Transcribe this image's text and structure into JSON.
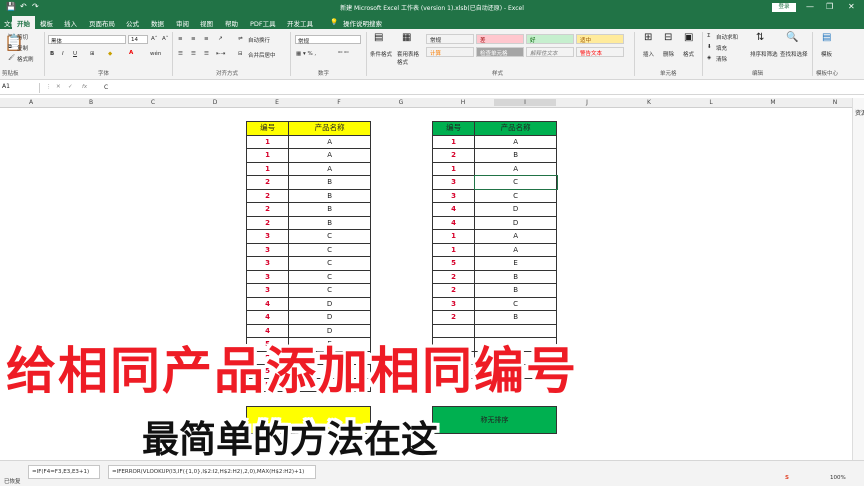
{
  "window": {
    "title": "新建 Microsoft Excel 工作表 (version 1).xlsb(已自动还原)  -  Excel",
    "login_label": "登录",
    "minimize": "—",
    "restore": "❐",
    "close": "✕"
  },
  "tabs": [
    "文件",
    "开始",
    "模板",
    "插入",
    "页面布局",
    "公式",
    "数据",
    "审阅",
    "视图",
    "帮助",
    "PDF工具",
    "开发工具"
  ],
  "tell_me": "操作说明搜索",
  "ribbon": {
    "clipboard": {
      "cut": "剪切",
      "copy": "复制",
      "format_painter": "格式刷",
      "label": "剪贴板"
    },
    "font": {
      "name": "黑体",
      "size": "14",
      "label": "字体",
      "bold": "B",
      "italic": "I",
      "underline": "U",
      "font_color_glyph": "A"
    },
    "alignment": {
      "wrap": "自动换行",
      "merge": "合并后居中",
      "label": "对齐方式"
    },
    "number": {
      "format": "常规",
      "label": "数字"
    },
    "styles": {
      "conditional": "条件格式",
      "table": "套用表格格式",
      "cells": [
        {
          "text": "常规",
          "bg": "#ffffff",
          "fg": "#222222"
        },
        {
          "text": "差",
          "bg": "#ffc7ce",
          "fg": "#9c0006"
        },
        {
          "text": "好",
          "bg": "#c6efce",
          "fg": "#006100"
        },
        {
          "text": "适中",
          "bg": "#ffeb9c",
          "fg": "#9c5700"
        },
        {
          "text": "计算",
          "bg": "#f2f2f2",
          "fg": "#fa7d00"
        },
        {
          "text": "检查单元格",
          "bg": "#a5a5a5",
          "fg": "#ffffff"
        },
        {
          "text": "解释性文本",
          "bg": "#ffffff",
          "fg": "#7f7f7f"
        },
        {
          "text": "警告文本",
          "bg": "#ffffff",
          "fg": "#ff0000"
        }
      ],
      "label": "样式"
    },
    "cells_group": {
      "insert": "插入",
      "delete": "删除",
      "format": "格式",
      "label": "单元格"
    },
    "editing": {
      "autosum": "自动求和",
      "fill": "填充",
      "clear": "清除",
      "sort": "排序和筛选",
      "find": "查找和选择",
      "label": "编辑"
    },
    "templates": {
      "label": "模板",
      "center": "模板中心"
    }
  },
  "formula_bar": {
    "name_box": "A1",
    "value": "C"
  },
  "columns": [
    "A",
    "B",
    "C",
    "D",
    "E",
    "F",
    "G",
    "H",
    "I",
    "J",
    "K",
    "L",
    "M",
    "N"
  ],
  "colors": {
    "excel_green": "#217346",
    "yellow_header": "#ffff00",
    "green_header": "#00b050",
    "red": "#ee1c25"
  },
  "left_table": {
    "headers": [
      "编号",
      "产品名称"
    ],
    "rows": [
      [
        "1",
        "A"
      ],
      [
        "1",
        "A"
      ],
      [
        "1",
        "A"
      ],
      [
        "2",
        "B"
      ],
      [
        "2",
        "B"
      ],
      [
        "2",
        "B"
      ],
      [
        "2",
        "B"
      ],
      [
        "3",
        "C"
      ],
      [
        "3",
        "C"
      ],
      [
        "3",
        "C"
      ],
      [
        "3",
        "C"
      ],
      [
        "3",
        "C"
      ],
      [
        "4",
        "D"
      ],
      [
        "4",
        "D"
      ],
      [
        "4",
        "D"
      ],
      [
        "5",
        "E"
      ],
      [
        "5",
        "E"
      ],
      [
        "5",
        "E"
      ],
      [
        "5",
        "E"
      ]
    ]
  },
  "right_table": {
    "headers": [
      "编号",
      "产品名称"
    ],
    "rows": [
      [
        "1",
        "A"
      ],
      [
        "2",
        "B"
      ],
      [
        "1",
        "A"
      ],
      [
        "3",
        "C"
      ],
      [
        "3",
        "C"
      ],
      [
        "4",
        "D"
      ],
      [
        "4",
        "D"
      ],
      [
        "1",
        "A"
      ],
      [
        "1",
        "A"
      ],
      [
        "5",
        "E"
      ],
      [
        "2",
        "B"
      ],
      [
        "2",
        "B"
      ],
      [
        "3",
        "C"
      ],
      [
        "2",
        "B"
      ],
      [
        "",
        ""
      ],
      [
        "",
        ""
      ],
      [
        "3",
        ""
      ],
      [
        "2",
        "B"
      ]
    ],
    "footer": "称无排序"
  },
  "overlay": {
    "headline": "给相同产品添加相同编号",
    "subline": "最简单的方法在这"
  },
  "bottom": {
    "status": "已恢复",
    "formula_left": "=IF(F4=F3,E3,E3+1)",
    "formula_right": "=IFERROR(VLOOKUP(I3,IF({1,0},I$2:I2,H$2:H2),2,0),MAX(H$2:H2)+1)",
    "zoom": "100%",
    "sidebar_label": "资源"
  }
}
